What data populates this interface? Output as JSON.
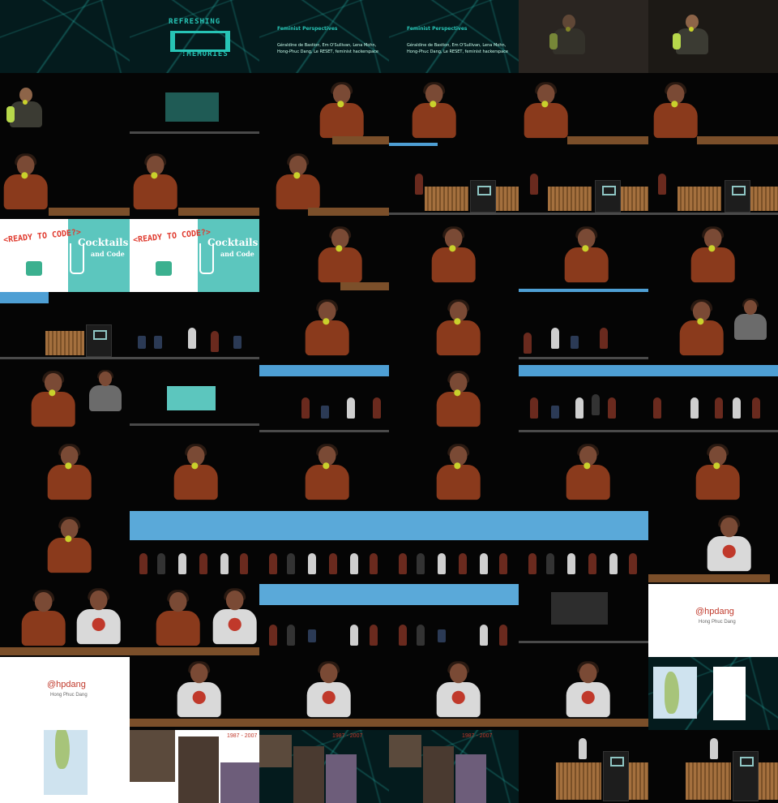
{
  "sheet": {
    "columns": 6,
    "rows": 11,
    "background": "#000000"
  },
  "slides": {
    "refreshing": "REFRESHING",
    "memories": ":MEMORIES",
    "feminist_title": "Feminist Perspectives",
    "feminist_names": "Géraldine de Bastion, Em O'Sullivan, Lena Mohn, Hong-Phuc Dang, Le RESET, feminist hackerspace",
    "ready_to_code": "<READY TO CODE?>",
    "cocktails": "Cocktails",
    "and_code": "and Code",
    "handle": "@hpdang",
    "handle_name": "Hong Phuc Dang",
    "years": "1987 - 2007"
  },
  "colors": {
    "accent_teal": "#27c4b5",
    "brick": "#8a3a1c",
    "handle_red": "#c0392b",
    "stage_blue": "#4e9fd4"
  }
}
